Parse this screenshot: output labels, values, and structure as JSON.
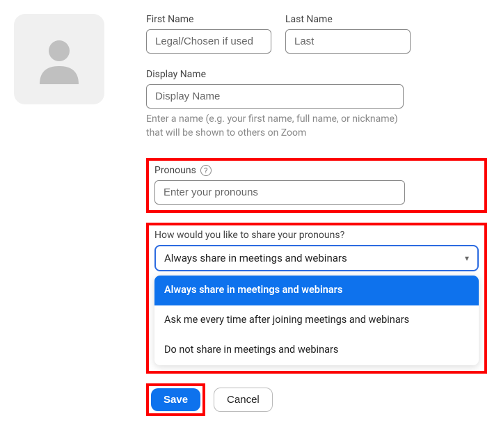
{
  "labels": {
    "first_name": "First Name",
    "last_name": "Last Name",
    "display_name": "Display Name",
    "pronouns": "Pronouns",
    "share_question": "How would you like to share your pronouns?"
  },
  "placeholders": {
    "first_name": "Legal/Chosen if used",
    "last_name": "Last",
    "display_name": "Display Name",
    "pronouns": "Enter your pronouns"
  },
  "helper": {
    "display_name": "Enter a name (e.g. your first name, full name, or nickname) that will be shown to others on Zoom"
  },
  "share": {
    "selected": "Always share in meetings and webinars",
    "options": [
      "Always share in meetings and webinars",
      "Ask me every time after joining meetings and webinars",
      "Do not share in meetings and webinars"
    ]
  },
  "buttons": {
    "save": "Save",
    "cancel": "Cancel"
  }
}
